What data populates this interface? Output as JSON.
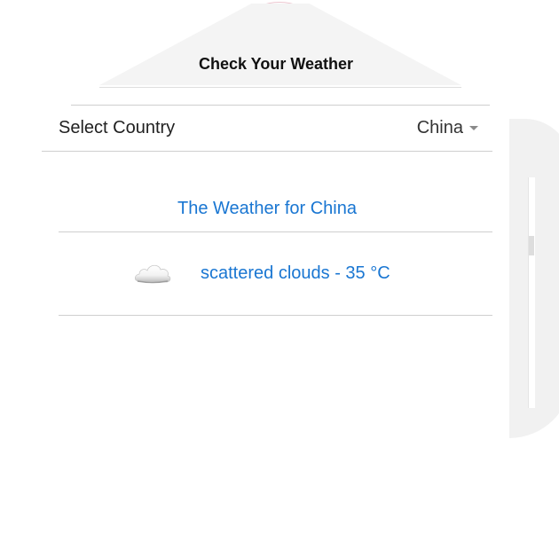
{
  "header": {
    "title": "Check Your Weather"
  },
  "country_select": {
    "label": "Select Country",
    "selected": "China"
  },
  "weather": {
    "heading": "The Weather for China",
    "description": "scattered clouds - 35 °C",
    "icon": "cloud-icon"
  },
  "colors": {
    "accent": "#1976d2",
    "header_bg": "#f4f4f4",
    "divider": "#cfcfcf"
  }
}
